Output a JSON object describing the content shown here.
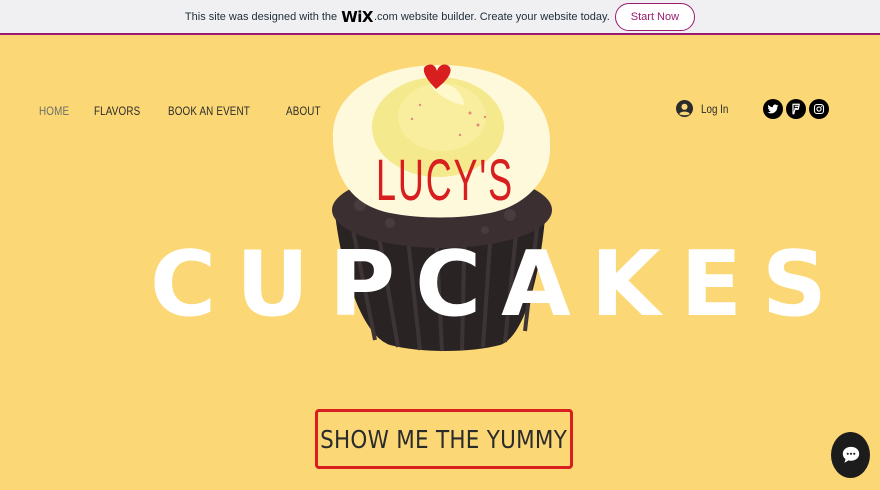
{
  "wix_banner": {
    "text_before": "This site was designed with the",
    "logo": "WiX",
    "logo_suffix": ".com",
    "text_after": "website builder. Create your website today.",
    "button_label": "Start Now"
  },
  "nav": {
    "items": [
      {
        "label": "HOME",
        "active": true
      },
      {
        "label": "FLAVORS",
        "active": false
      },
      {
        "label": "BOOK AN EVENT",
        "active": false
      },
      {
        "label": "ABOUT",
        "active": false
      }
    ]
  },
  "login": {
    "label": "Log In",
    "icon": "user-avatar-icon"
  },
  "social": [
    {
      "name": "twitter",
      "icon": "twitter-icon"
    },
    {
      "name": "foursquare",
      "icon": "foursquare-icon"
    },
    {
      "name": "instagram",
      "icon": "instagram-icon"
    }
  ],
  "hero": {
    "brand_name": "LUCY'S",
    "headline": "CUPCAKES",
    "cta_label": "SHOW ME THE YUMMY"
  },
  "chat": {
    "icon": "chat-bubble-icon"
  },
  "colors": {
    "background": "#fbd775",
    "accent_red": "#d81e1e",
    "wix_purple": "#9a1c6f",
    "text_dark": "#2b2b2b"
  }
}
